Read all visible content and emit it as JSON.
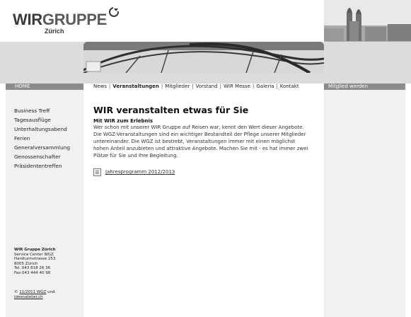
{
  "logo": {
    "brand_main": "WIR",
    "brand_second": "GRUPPE",
    "brand_sub": "Zürich",
    "icon": "circular-arrow-mark-icon"
  },
  "header_photo": {
    "icon": "church-towers-photo"
  },
  "banner": {
    "icon": "rollercoaster-photo"
  },
  "left_bar": {
    "label": "HOME"
  },
  "right_bar": {
    "label": "Mitglied werden"
  },
  "top_nav": {
    "items": [
      "News",
      "Veranstaltungen",
      "Mitglieder",
      "Vorstand",
      "WIR Messe",
      "Galeria",
      "Kontakt"
    ],
    "active": "Veranstaltungen",
    "separator": "|"
  },
  "side_nav": {
    "items": [
      "Business Treff",
      "Tagesausflüge",
      "Unterhaltungsabend",
      "Ferien",
      "Generalversammlung",
      "Genossenschafter",
      "Präsidententreffen"
    ]
  },
  "content": {
    "title": "WIR veranstalten etwas für Sie",
    "subheading": "Mit WIR zum Erlebnis",
    "paragraph_lines": [
      "Wer schon mit unserer WIR Gruppe auf Reisen war, kennt den Wert dieser Angebote.",
      "Die WGZ-Veranstaltungen sind ein wichtiger Bestandteil der Pflege unserer Mitglieder",
      "untereinander. Die WGZ ist bestrebt, Veranstaltungen immer mit einen möglichst",
      "hohen Anteil anzubieten und attraktive Angebote. Machen Sie mit - es hat immer zwei",
      "Plätze für Sie und Ihre Begleitung."
    ],
    "document": {
      "icon": "document-icon",
      "link_label": "Jahresprogramm 2012/2013"
    }
  },
  "address": {
    "name": "WIR Gruppe Zürich",
    "lines": [
      "Service Center WGZ",
      "Hardturmstrasse 253",
      "8005 Zürich",
      "Tel. 043 818 26 36",
      "Fax 043 444 40 98"
    ]
  },
  "footer": {
    "copyright_symbol": "©",
    "date_link": "11/2011 WGZ",
    "and_word": "und",
    "credit_link": "ideenatelier.ch"
  },
  "colors": {
    "bar_gray": "#8c8c8c",
    "band_gray": "#dcdcdc",
    "column_gray": "#f1f1f1"
  }
}
